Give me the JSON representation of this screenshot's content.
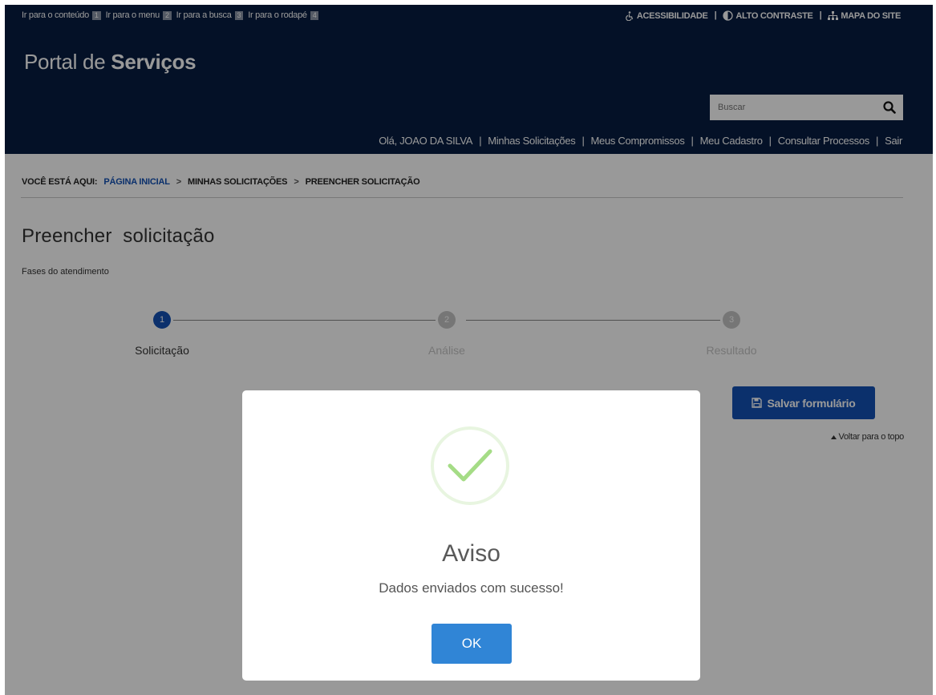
{
  "colors": {
    "header_bg": "#071d41",
    "primary": "#1351b4",
    "step_inactive": "#c5c5c5",
    "success_check": "#a5dc86",
    "ok_button": "#3085d6"
  },
  "skip_links": [
    {
      "label": "Ir para o conteúdo",
      "key": "1"
    },
    {
      "label": "Ir para o menu",
      "key": "2"
    },
    {
      "label": "Ir para a busca",
      "key": "3"
    },
    {
      "label": "Ir para o rodapé",
      "key": "4"
    }
  ],
  "top_tools": {
    "accessibility": "ACESSIBILIDADE",
    "contrast": "ALTO CONTRASTE",
    "sitemap": "MAPA DO SITE"
  },
  "portal": {
    "title_light": "Portal de ",
    "title_bold": "Serviços"
  },
  "search": {
    "placeholder": "Buscar",
    "icon": "search-icon"
  },
  "user_nav": {
    "greeting": "Olá, JOAO DA SILVA",
    "items": [
      "Minhas Solicitações",
      "Meus Compromissos",
      "Meu Cadastro",
      "Consultar Processos",
      "Sair"
    ]
  },
  "breadcrumb": {
    "prefix": "VOCÊ ESTÁ AQUI:",
    "items": [
      "PÁGINA INICIAL",
      "MINHAS SOLICITAÇÕES",
      "PREENCHER SOLICITAÇÃO"
    ],
    "separator": ">"
  },
  "page": {
    "title": "Preencher  solicitação",
    "phases_label": "Fases do atendimento"
  },
  "steps": [
    {
      "number": "1",
      "label": "Solicitação",
      "active": true
    },
    {
      "number": "2",
      "label": "Análise",
      "active": false
    },
    {
      "number": "3",
      "label": "Resultado",
      "active": false
    }
  ],
  "actions": {
    "save_label": "Salvar formulário",
    "back_to_top": "Voltar para o topo"
  },
  "modal": {
    "title": "Aviso",
    "message": "Dados enviados com sucesso!",
    "ok_label": "OK",
    "icon": "check-icon"
  }
}
